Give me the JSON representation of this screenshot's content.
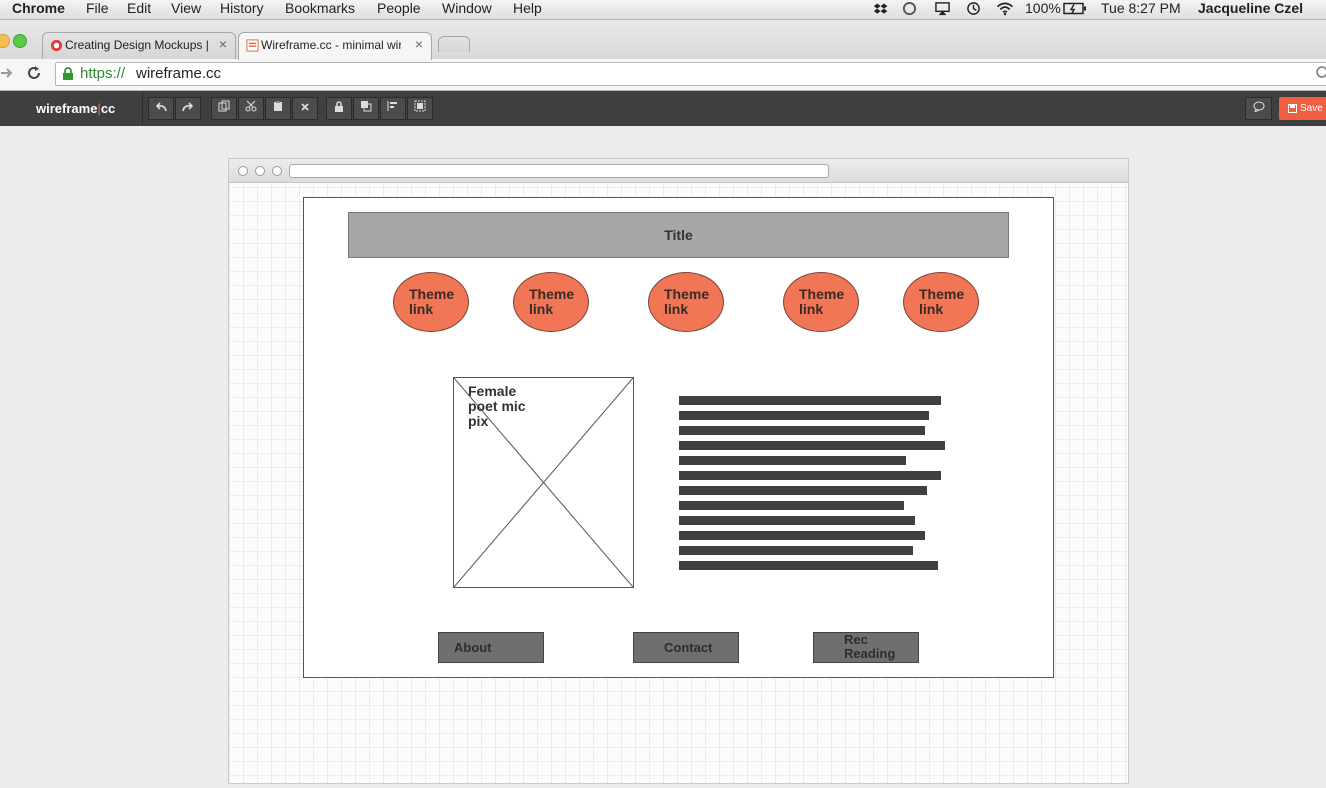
{
  "menubar": {
    "app": "Chrome",
    "items": [
      "File",
      "Edit",
      "View",
      "History",
      "Bookmarks",
      "People",
      "Window",
      "Help"
    ],
    "battery": "100%",
    "clock": "Tue 8:27 PM",
    "user": "Jacqueline Czel"
  },
  "tabs": [
    {
      "title": "Creating Design Mockups |"
    },
    {
      "title": "Wireframe.cc - minimal wir"
    }
  ],
  "address": {
    "scheme": "https://",
    "host": "wireframe.cc"
  },
  "appbar": {
    "logo_main": "wireframe",
    "logo_suffix": "cc",
    "save_label": "Save"
  },
  "wireframe": {
    "title": "Title",
    "theme_links": [
      "Theme link",
      "Theme link",
      "Theme link",
      "Theme link",
      "Theme link"
    ],
    "image_label": "Female poet mic pix",
    "text_block_lines": 12,
    "buttons": [
      "About",
      "Contact",
      "Rec Reading"
    ]
  },
  "colors": {
    "theme_link_fill": "#f07655",
    "save_button": "#ef5f3f",
    "app_toolbar": "#3f3f3f"
  }
}
